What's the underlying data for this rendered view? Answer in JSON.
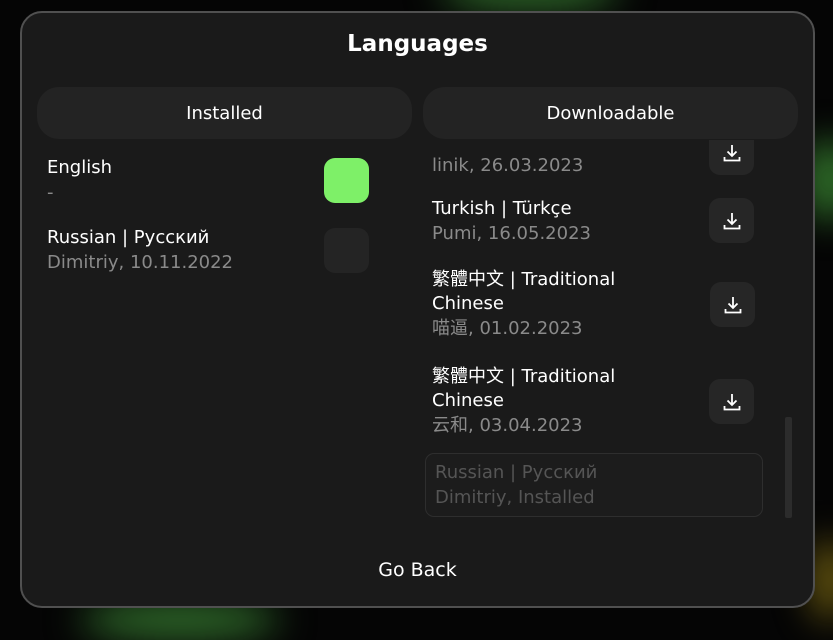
{
  "dialog": {
    "title": "Languages",
    "back_label": "Go Back"
  },
  "tabs": [
    {
      "label": "Installed"
    },
    {
      "label": "Downloadable"
    }
  ],
  "installed": [
    {
      "name": "English",
      "sub": "-",
      "active": true
    },
    {
      "name": "Russian | Русский",
      "sub": "Dimitriy, 10.11.2022",
      "active": false
    }
  ],
  "downloadable": [
    {
      "sub": "linik, 26.03.2023"
    },
    {
      "name": "Turkish | Türkçe",
      "sub": "Pumi, 16.05.2023"
    },
    {
      "name": "繁體中文 | Traditional Chinese",
      "sub": "喵逼, 01.02.2023"
    },
    {
      "name": "繁體中文 | Traditional Chinese",
      "sub": "云和, 03.04.2023"
    },
    {
      "name": "Russian | Русский",
      "sub": "Dimitriy, Installed",
      "disabled": true
    }
  ],
  "colors": {
    "accent": "#7ef068",
    "modal_bg": "#1a1a1a",
    "tab_bg": "#232323"
  },
  "icons": {
    "download": "download-icon"
  }
}
